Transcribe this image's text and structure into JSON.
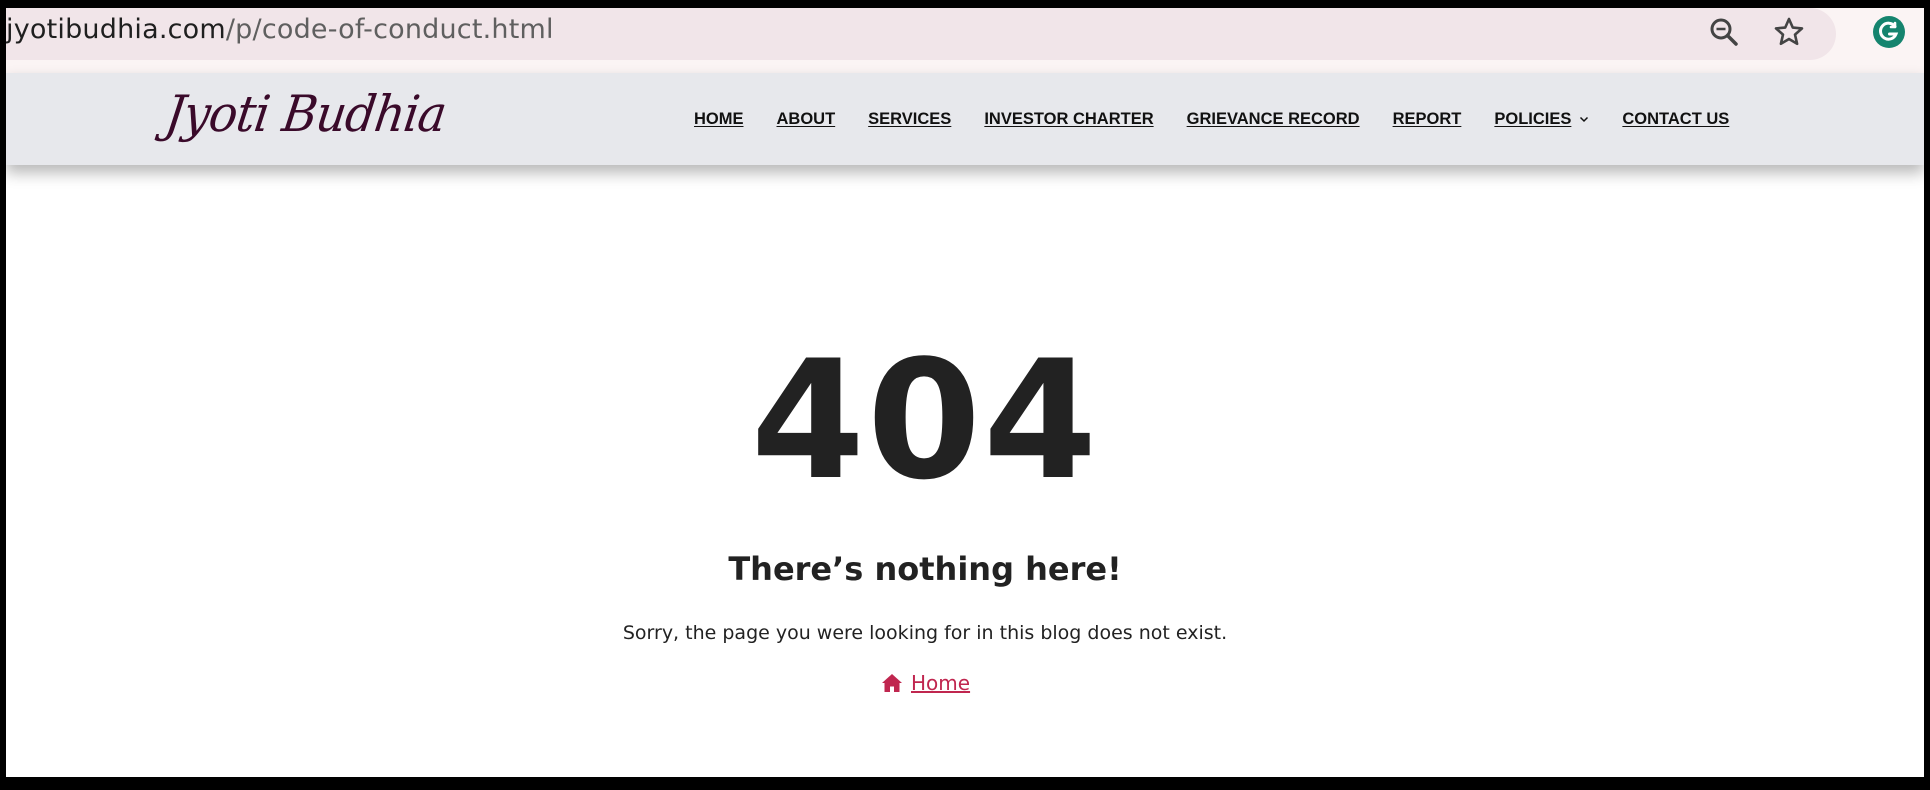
{
  "browser": {
    "url_domain": "jyotibudhia.com",
    "url_path": "/p/code-of-conduct.html",
    "icons": [
      "zoom-out-icon",
      "bookmark-star-icon",
      "grammarly-icon"
    ]
  },
  "site": {
    "logo_text": "Jyoti Budhia",
    "nav": [
      {
        "label": "HOME"
      },
      {
        "label": "ABOUT"
      },
      {
        "label": "SERVICES"
      },
      {
        "label": "INVESTOR CHARTER"
      },
      {
        "label": "GRIEVANCE RECORD"
      },
      {
        "label": "REPORT"
      },
      {
        "label": "POLICIES",
        "has_dropdown": true
      },
      {
        "label": "CONTACT US"
      }
    ]
  },
  "error": {
    "code": "404",
    "headline": "There’s nothing here!",
    "message": "Sorry, the page you were looking for in this blog does not exist.",
    "home_link": "Home",
    "home_icon": "home-icon"
  },
  "colors": {
    "accent": "#c0264f",
    "header_bg": "#e7e8ec",
    "logo": "#3a0a2a",
    "text": "#222222"
  }
}
